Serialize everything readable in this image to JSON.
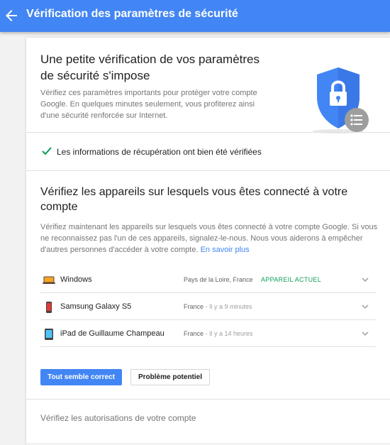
{
  "header": {
    "back_icon": "arrow-back-icon",
    "title": "Vérification des paramètres de sécurité"
  },
  "intro": {
    "title": "Une petite vérification de vos paramètres de sécurité s'impose",
    "text": "Vérifiez ces paramètres importants pour protéger votre compte Google. En quelques minutes seulement, vous profiterez ainsi d'une sécurité renforcée sur Internet.",
    "illustration_icon": "shield-lock-icon"
  },
  "recovery": {
    "icon": "check-icon",
    "text": "Les informations de récupération ont bien été vérifiées"
  },
  "devices": {
    "title": "Vérifiez les appareils sur lesquels vous êtes connecté à votre compte",
    "text": "Vérifiez maintenant les appareils sur lesquels vous êtes connecté à votre compte Google. Si vous ne reconnaissez pas l'un de ces appareils, signalez-le-nous. Nous vous aiderons à empêcher d'autres personnes d'accéder à votre compte.",
    "link": "En savoir plus",
    "items": [
      {
        "name": "Windows",
        "icon": "laptop-icon",
        "location": "Pays de la Loire, France",
        "time": "",
        "badge": "APPAREIL ACTUEL"
      },
      {
        "name": "Samsung Galaxy S5",
        "icon": "phone-icon",
        "location": "France",
        "time": " - Il y a 9 minutes",
        "badge": ""
      },
      {
        "name": "iPad de Guillaume Champeau",
        "icon": "tablet-icon",
        "location": "France",
        "time": " - Il y a 14 heures",
        "badge": ""
      }
    ],
    "confirm_button": "Tout semble correct",
    "problem_button": "Problème potentiel"
  },
  "permissions": {
    "title": "Vérifiez les autorisations de votre compte"
  },
  "colors": {
    "accent": "#4285f4",
    "success": "#0f9d58",
    "background": "#f2f2f2"
  }
}
